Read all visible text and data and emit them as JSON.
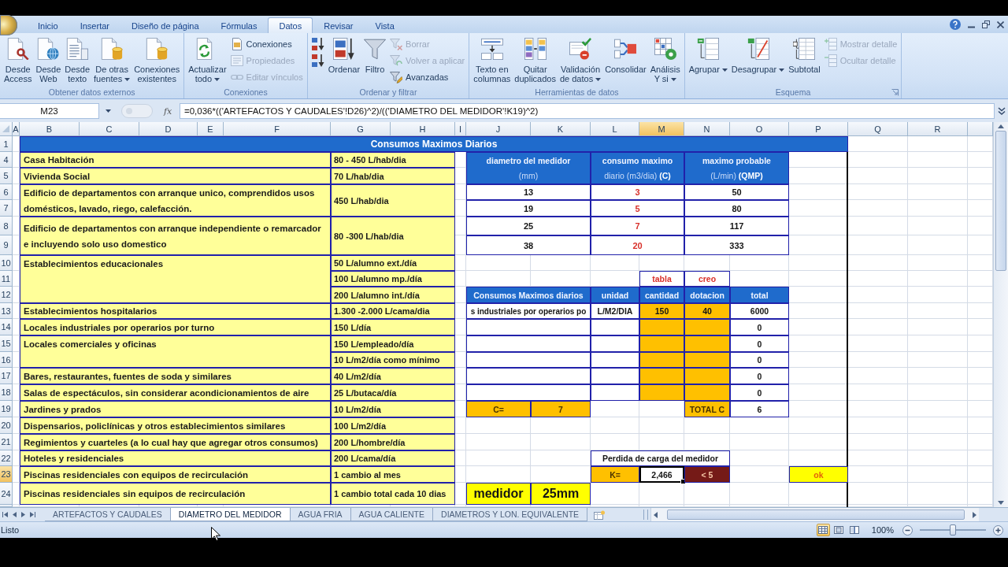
{
  "ribbon": {
    "tabs": [
      {
        "label": "Inicio",
        "selected": false
      },
      {
        "label": "Insertar",
        "selected": false
      },
      {
        "label": "Diseño de página",
        "selected": false
      },
      {
        "label": "Fórmulas",
        "selected": false
      },
      {
        "label": "Datos",
        "selected": true
      },
      {
        "label": "Revisar",
        "selected": false
      },
      {
        "label": "Vista",
        "selected": false
      }
    ],
    "groups": [
      {
        "label": "Obtener datos externos",
        "dialog_launcher": false,
        "items": [
          {
            "kind": "large",
            "label": "Desde\nAccess",
            "disabled": false,
            "dropdown": false
          },
          {
            "kind": "large",
            "label": "Desde\nWeb",
            "disabled": false,
            "dropdown": false
          },
          {
            "kind": "large",
            "label": "Desde\ntexto",
            "disabled": false,
            "dropdown": false
          },
          {
            "kind": "large",
            "label": "De otras\nfuentes",
            "disabled": false,
            "dropdown": true
          },
          {
            "kind": "large",
            "label": "Conexiones\nexistentes",
            "disabled": false,
            "dropdown": false
          }
        ]
      },
      {
        "label": "Conexiones",
        "dialog_launcher": false,
        "items": [
          {
            "kind": "large",
            "label": "Actualizar\ntodo",
            "disabled": false,
            "dropdown": true
          },
          {
            "kind": "small",
            "label": "Conexiones",
            "disabled": false,
            "dropdown": false
          },
          {
            "kind": "small",
            "label": "Propiedades",
            "disabled": true,
            "dropdown": false
          },
          {
            "kind": "small",
            "label": "Editar vínculos",
            "disabled": true,
            "dropdown": false
          }
        ]
      },
      {
        "label": "Ordenar y filtrar",
        "dialog_launcher": false,
        "items": [
          {
            "kind": "small",
            "disabled": false,
            "dropdown": false
          },
          {
            "kind": "small",
            "disabled": false,
            "dropdown": false
          },
          {
            "kind": "large",
            "label": "Ordenar",
            "disabled": false,
            "dropdown": false
          },
          {
            "kind": "large",
            "label": "Filtro",
            "disabled": false,
            "dropdown": false
          },
          {
            "kind": "small",
            "label": "Borrar",
            "disabled": true,
            "dropdown": false
          },
          {
            "kind": "small",
            "label": "Volver a aplicar",
            "disabled": true,
            "dropdown": false
          },
          {
            "kind": "small",
            "label": "Avanzadas",
            "disabled": false,
            "dropdown": false
          }
        ]
      },
      {
        "label": "Herramientas de datos",
        "dialog_launcher": false,
        "items": [
          {
            "kind": "large",
            "label": "Texto en\ncolumnas",
            "disabled": false,
            "dropdown": false
          },
          {
            "kind": "large",
            "label": "Quitar\nduplicados",
            "disabled": false,
            "dropdown": false
          },
          {
            "kind": "large",
            "label": "Validación\nde datos",
            "disabled": false,
            "dropdown": true
          },
          {
            "kind": "large",
            "label": "Consolidar",
            "disabled": false,
            "dropdown": false
          },
          {
            "kind": "large",
            "label": "Análisis\nY si",
            "disabled": false,
            "dropdown": true
          }
        ]
      },
      {
        "label": "Esquema",
        "dialog_launcher": true,
        "items": [
          {
            "kind": "large",
            "label": "Agrupar",
            "disabled": false,
            "dropdown": true
          },
          {
            "kind": "large",
            "label": "Desagrupar",
            "disabled": false,
            "dropdown": true
          },
          {
            "kind": "large",
            "label": "Subtotal",
            "disabled": false,
            "dropdown": false
          },
          {
            "kind": "small",
            "label": "Mostrar detalle",
            "disabled": true,
            "dropdown": false
          },
          {
            "kind": "small",
            "label": "Ocultar detalle",
            "disabled": true,
            "dropdown": false
          }
        ]
      }
    ]
  },
  "formula_bar": {
    "name_box": "M23",
    "function_button": "fx",
    "formula": "=0,036*(('ARTEFACTOS Y CAUDALES'!D26)^2)/(('DIAMETRO DEL MEDIDOR'!K19)^2)"
  },
  "sheet": {
    "columns": [
      {
        "label": "A",
        "selected": false
      },
      {
        "label": "B",
        "selected": false
      },
      {
        "label": "C",
        "selected": false
      },
      {
        "label": "D",
        "selected": false
      },
      {
        "label": "E",
        "selected": false
      },
      {
        "label": "F",
        "selected": false
      },
      {
        "label": "G",
        "selected": false
      },
      {
        "label": "H",
        "selected": false
      },
      {
        "label": "I",
        "selected": false
      },
      {
        "label": "J",
        "selected": false
      },
      {
        "label": "K",
        "selected": false
      },
      {
        "label": "L",
        "selected": false
      },
      {
        "label": "M",
        "selected": true
      },
      {
        "label": "N",
        "selected": false
      },
      {
        "label": "O",
        "selected": false
      },
      {
        "label": "P",
        "selected": false
      },
      {
        "label": "Q",
        "selected": false
      },
      {
        "label": "R",
        "selected": false
      }
    ],
    "rows": [
      {
        "label": "1",
        "selected": false
      },
      {
        "label": "4",
        "selected": false
      },
      {
        "label": "5",
        "selected": false
      },
      {
        "label": "6",
        "selected": false
      },
      {
        "label": "7",
        "selected": false
      },
      {
        "label": "8",
        "selected": false
      },
      {
        "label": "9",
        "selected": false
      },
      {
        "label": "10",
        "selected": false
      },
      {
        "label": "11",
        "selected": false
      },
      {
        "label": "12",
        "selected": false
      },
      {
        "label": "13",
        "selected": false
      },
      {
        "label": "14",
        "selected": false
      },
      {
        "label": "15",
        "selected": false
      },
      {
        "label": "16",
        "selected": false
      },
      {
        "label": "17",
        "selected": false
      },
      {
        "label": "18",
        "selected": false
      },
      {
        "label": "19",
        "selected": false
      },
      {
        "label": "20",
        "selected": false
      },
      {
        "label": "21",
        "selected": false
      },
      {
        "label": "22",
        "selected": false
      },
      {
        "label": "23",
        "selected": true
      },
      {
        "label": "24",
        "selected": false
      }
    ],
    "title": "Consumos Maximos Diarios",
    "consumption_table": [
      {
        "use": "Casa Habitación",
        "allowances": [
          "80 - 450 L/hab/dia"
        ]
      },
      {
        "use": "Vivienda Social",
        "allowances": [
          "70 L/hab/dia"
        ]
      },
      {
        "use": "Edificio de departamentos con arranque unico, comprendidos usos domésticos, lavado, riego, calefacción.",
        "allowances": [
          "450 L/hab/dia"
        ]
      },
      {
        "use": "Edificio de departamentos con arranque independiente o remarcador e incluyendo solo uso domestico",
        "allowances": [
          "80 -300 L/hab/dia"
        ]
      },
      {
        "use": "Establecimientos educacionales",
        "allowances": [
          "50 L/alumno ext./día",
          "100 L/alumno mp./día",
          "200 L/alumno int./día"
        ]
      },
      {
        "use": "Establecimientos hospitalarios",
        "allowances": [
          "1.300 -2.000 L/cama/dia"
        ]
      },
      {
        "use": "Locales industriales por operarios por turno",
        "allowances": [
          "150 L/día"
        ]
      },
      {
        "use": "Locales comerciales y oficinas",
        "allowances": [
          "150 L/empleado/día",
          "10 L/m2/día como mínimo"
        ]
      },
      {
        "use": "Bares, restaurantes, fuentes de soda y similares",
        "allowances": [
          "40 L/m2/día"
        ]
      },
      {
        "use": "Salas de espectáculos, sin considerar acondicionamientos de aire",
        "allowances": [
          "25 L/butaca/día"
        ]
      },
      {
        "use": "Jardines y prados",
        "allowances": [
          "10 L/m2/día"
        ]
      },
      {
        "use": "Dispensarios, policlínicas y otros establecimientos similares",
        "allowances": [
          "100 L/m2/día"
        ]
      },
      {
        "use": "Regimientos y cuarteles (a lo cual hay que agregar otros consumos)",
        "allowances": [
          "200 L/hombre/día"
        ]
      },
      {
        "use": "Hoteles y residenciales",
        "allowances": [
          "200 L/cama/día"
        ]
      },
      {
        "use": "Piscinas residenciales con equipos de recirculación",
        "allowances": [
          "1 cambio al mes"
        ]
      },
      {
        "use": "Piscinas residenciales sin equipos de recirculación",
        "allowances": [
          "1 cambio total cada 10 dias"
        ]
      }
    ],
    "meter_table": {
      "columns": [
        {
          "title": "diametro del medidor",
          "subtitle": "(mm)"
        },
        {
          "title": "consumo maximo",
          "subtitle": "diario (m3/dia) **(C)**"
        },
        {
          "title": "maximo probable",
          "subtitle": "(L/min) **(QMP)**"
        }
      ],
      "rows": [
        {
          "diameter": "13",
          "consumption": "3",
          "probable": "50"
        },
        {
          "diameter": "19",
          "consumption": "5",
          "probable": "80"
        },
        {
          "diameter": "25",
          "consumption": "7",
          "probable": "117"
        },
        {
          "diameter": "38",
          "consumption": "20",
          "probable": "333"
        }
      ]
    },
    "calc_table": {
      "notes": [
        "tabla",
        "creo"
      ],
      "columns": [
        "Consumos Maximos diarios",
        "unidad",
        "cantidad",
        "dotacion",
        "total"
      ],
      "rows": [
        {
          "use": "s industriales por operarios po",
          "unit": "L/M2/DIA",
          "quantity": "150",
          "allowance": "40",
          "total": "6000"
        },
        {
          "total": "0"
        },
        {
          "total": "0"
        },
        {
          "total": "0"
        },
        {
          "total": "0"
        },
        {
          "total": "0"
        }
      ],
      "c_label": "C=",
      "c_value": "7",
      "total_label": "TOTAL C",
      "total_value": "6"
    },
    "head_loss": {
      "title": "Perdida de carga del medidor",
      "k_label": "K=",
      "k_value": "2,466",
      "limit": "< 5",
      "result": "ok"
    },
    "meter_result": {
      "label": "medidor",
      "value": "25mm"
    }
  },
  "sheet_tabs": [
    {
      "label": "ARTEFACTOS Y CAUDALES",
      "selected": false
    },
    {
      "label": "DIAMETRO DEL MEDIDOR",
      "selected": true
    },
    {
      "label": "AGUA FRIA",
      "selected": false
    },
    {
      "label": "AGUA CALIENTE",
      "selected": false
    },
    {
      "label": "DIAMETROS Y LON. EQUIVALENTE",
      "selected": false
    }
  ],
  "status_bar": {
    "status": "Listo",
    "views": [
      {
        "selected": true
      },
      {
        "selected": false
      },
      {
        "selected": false
      }
    ],
    "zoom": "100%",
    "zoom_slider": {
      "level": 0.5
    }
  }
}
